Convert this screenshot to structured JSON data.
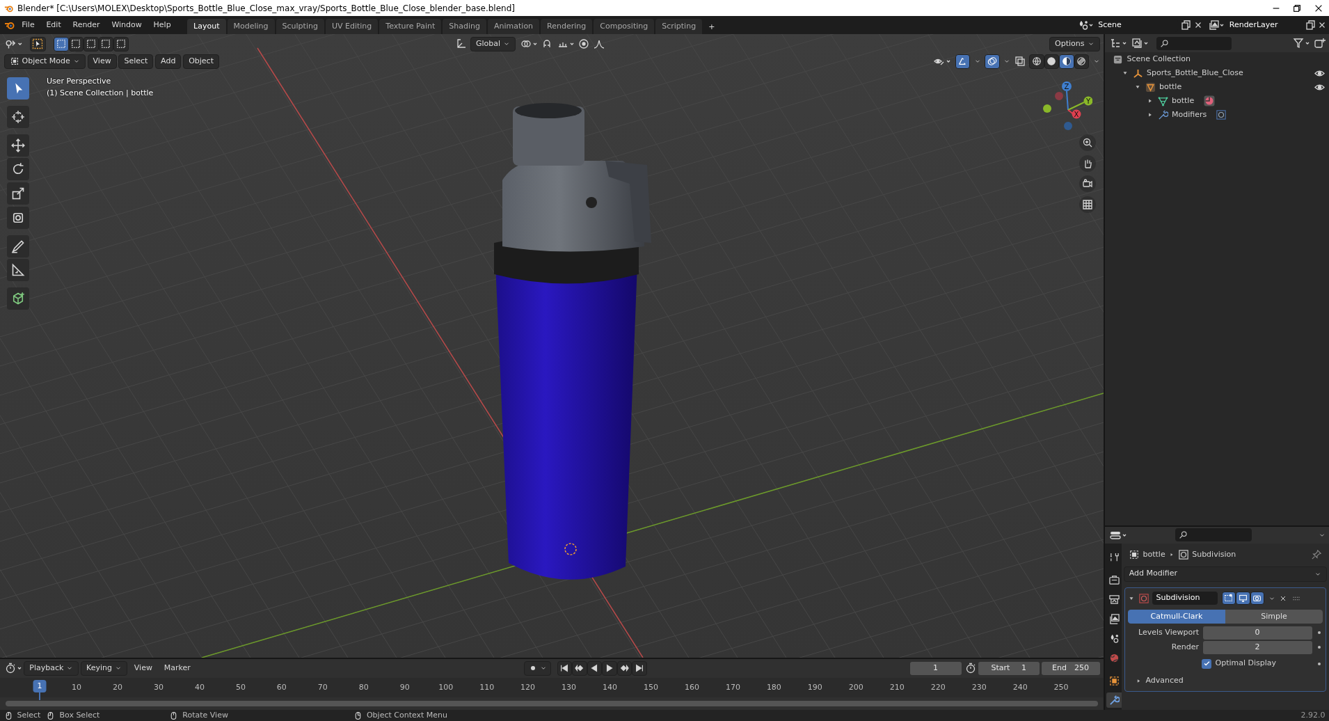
{
  "title_bar": {
    "title": "Blender* [C:\\Users\\MOLEX\\Desktop\\Sports_Bottle_Blue_Close_max_vray/Sports_Bottle_Blue_Close_blender_base.blend]"
  },
  "menu": [
    "File",
    "Edit",
    "Render",
    "Window",
    "Help"
  ],
  "workspaces": [
    {
      "label": "Layout",
      "selected": true
    },
    {
      "label": "Modeling",
      "selected": false
    },
    {
      "label": "Sculpting",
      "selected": false
    },
    {
      "label": "UV Editing",
      "selected": false
    },
    {
      "label": "Texture Paint",
      "selected": false
    },
    {
      "label": "Shading",
      "selected": false
    },
    {
      "label": "Animation",
      "selected": false
    },
    {
      "label": "Rendering",
      "selected": false
    },
    {
      "label": "Compositing",
      "selected": false
    },
    {
      "label": "Scripting",
      "selected": false
    }
  ],
  "add_workspace": "+",
  "scene": "Scene",
  "view_layer": "RenderLayer",
  "tool_header": {
    "orientation": "Global",
    "options": "Options"
  },
  "viewport_header": {
    "mode": "Object Mode",
    "menus": [
      "View",
      "Select",
      "Add",
      "Object"
    ],
    "shading": [
      {
        "kind": "wireframe",
        "selected": false
      },
      {
        "kind": "solid",
        "selected": false
      },
      {
        "kind": "material",
        "selected": true
      },
      {
        "kind": "rendered",
        "selected": false
      }
    ]
  },
  "tools": [
    {
      "kind": "select",
      "selected": true
    },
    {
      "kind": "cursor",
      "selected": false
    },
    {
      "kind": "move",
      "selected": false
    },
    {
      "kind": "rotate",
      "selected": false
    },
    {
      "kind": "scale",
      "selected": false
    },
    {
      "kind": "transform",
      "selected": false
    },
    {
      "kind": "annotate",
      "selected": false
    },
    {
      "kind": "measure",
      "selected": false
    },
    {
      "kind": "add_cube",
      "selected": false
    }
  ],
  "viewport": {
    "view_name": "User Perspective",
    "info": "(1) Scene Collection | bottle",
    "gizmo": {
      "z": "Z",
      "y": "Y",
      "x": "X"
    }
  },
  "outliner": {
    "root": "Scene Collection",
    "tree": [
      {
        "label": "Sports_Bottle_Blue_Close",
        "kind": "empty",
        "expanded": true,
        "children": [
          {
            "label": "bottle",
            "kind": "object",
            "expanded": true,
            "children": [
              {
                "label": "bottle",
                "kind": "mesh",
                "expanded": false
              },
              {
                "label": "Modifiers",
                "kind": "modifiers",
                "expanded": false
              }
            ]
          }
        ]
      }
    ]
  },
  "properties": {
    "tabs": [
      {
        "kind": "tool",
        "selected": false
      },
      {
        "kind": "render",
        "selected": false
      },
      {
        "kind": "output",
        "selected": false
      },
      {
        "kind": "view_layer",
        "selected": false
      },
      {
        "kind": "scene",
        "selected": false
      },
      {
        "kind": "world",
        "selected": false
      },
      {
        "kind": "object",
        "selected": false
      },
      {
        "kind": "modifiers",
        "selected": true
      }
    ],
    "object": "bottle",
    "modifier": "Subdivision",
    "add_modifier": "Add Modifier",
    "modifier_panel": {
      "name": "Subdivision",
      "expanded": true,
      "modes": [
        {
          "label": "Catmull-Clark",
          "selected": true
        },
        {
          "label": "Simple",
          "selected": false
        }
      ],
      "fields": [
        {
          "label": "Levels Viewport",
          "value": "0"
        },
        {
          "label": "Render",
          "value": "2"
        }
      ],
      "optimal_display": {
        "label": "Optimal Display",
        "checked": true
      },
      "advanced": {
        "label": "Advanced",
        "expanded": false
      }
    }
  },
  "timeline": {
    "menus": [
      "Playback",
      "Keying",
      "View",
      "Marker"
    ],
    "current_frame": "1",
    "start_label": "Start",
    "start": "1",
    "end_label": "End",
    "end": "250",
    "playhead": "1",
    "ticks": [
      "10",
      "20",
      "30",
      "40",
      "50",
      "60",
      "70",
      "80",
      "90",
      "100",
      "110",
      "120",
      "130",
      "140",
      "150",
      "160",
      "170",
      "180",
      "190",
      "200",
      "210",
      "220",
      "230",
      "240",
      "250"
    ]
  },
  "status_bar": {
    "items": [
      "Select",
      "Box Select",
      "Rotate View",
      "Object Context Menu"
    ],
    "version": "2.92.0"
  }
}
